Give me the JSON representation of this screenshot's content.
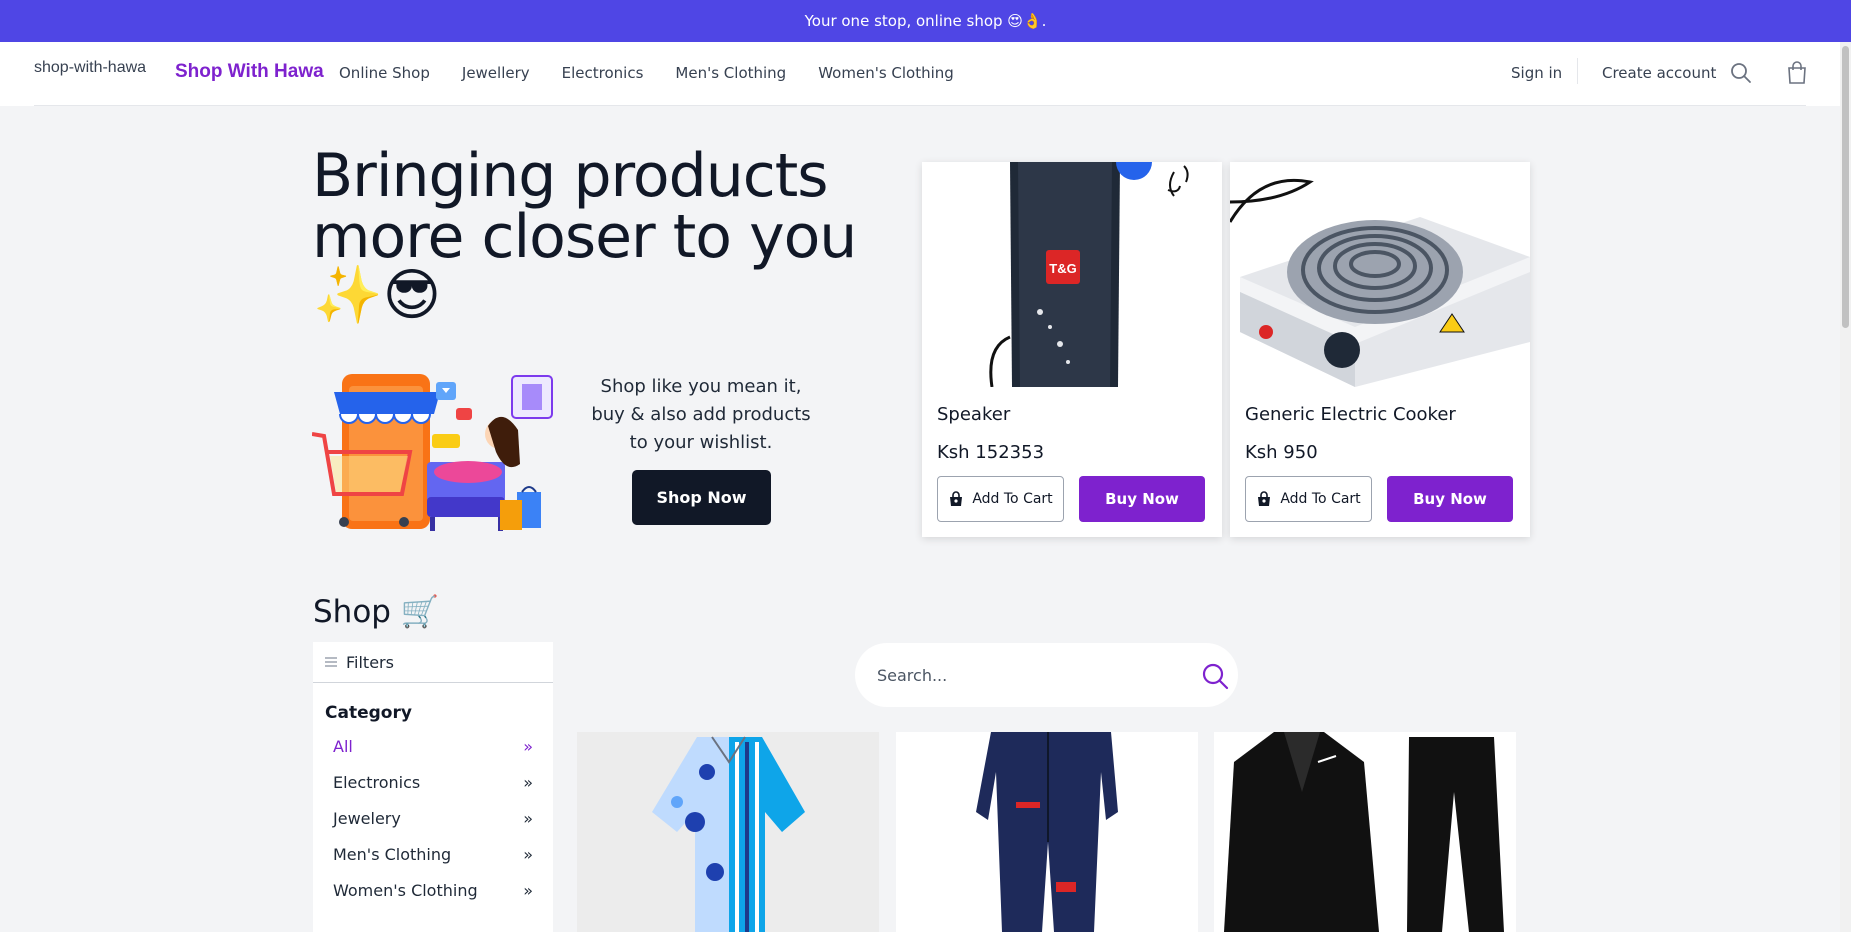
{
  "announcement": "Your one stop, online shop 😍👌.",
  "header": {
    "logo_alt": "shop-with-hawa",
    "brand": "Shop With Hawa",
    "nav": [
      "Online Shop",
      "Jewellery",
      "Electronics",
      "Men's Clothing",
      "Women's Clothing"
    ],
    "sign_in": "Sign in",
    "create_account": "Create account"
  },
  "hero": {
    "title": "Bringing products more closer to you",
    "emoji": "✨😎",
    "text": "Shop like you mean it, buy & also add products to your wishlist.",
    "cta": "Shop Now"
  },
  "featured": [
    {
      "name": "Speaker",
      "price": "Ksh 152353",
      "add_to_cart": "Add To Cart",
      "buy_now": "Buy Now",
      "badge": "T&G"
    },
    {
      "name": "Generic Electric Cooker",
      "price": "Ksh 950",
      "add_to_cart": "Add To Cart",
      "buy_now": "Buy Now"
    }
  ],
  "shop": {
    "title": "Shop 🛒",
    "filters_label": "Filters",
    "category_title": "Category",
    "categories": [
      "All",
      "Electronics",
      "Jewelery",
      "Men's Clothing",
      "Women's Clothing"
    ],
    "search_placeholder": "Search..."
  },
  "colors": {
    "primary": "#4f46e5",
    "accent": "#7e22ce",
    "dark": "#111827"
  }
}
